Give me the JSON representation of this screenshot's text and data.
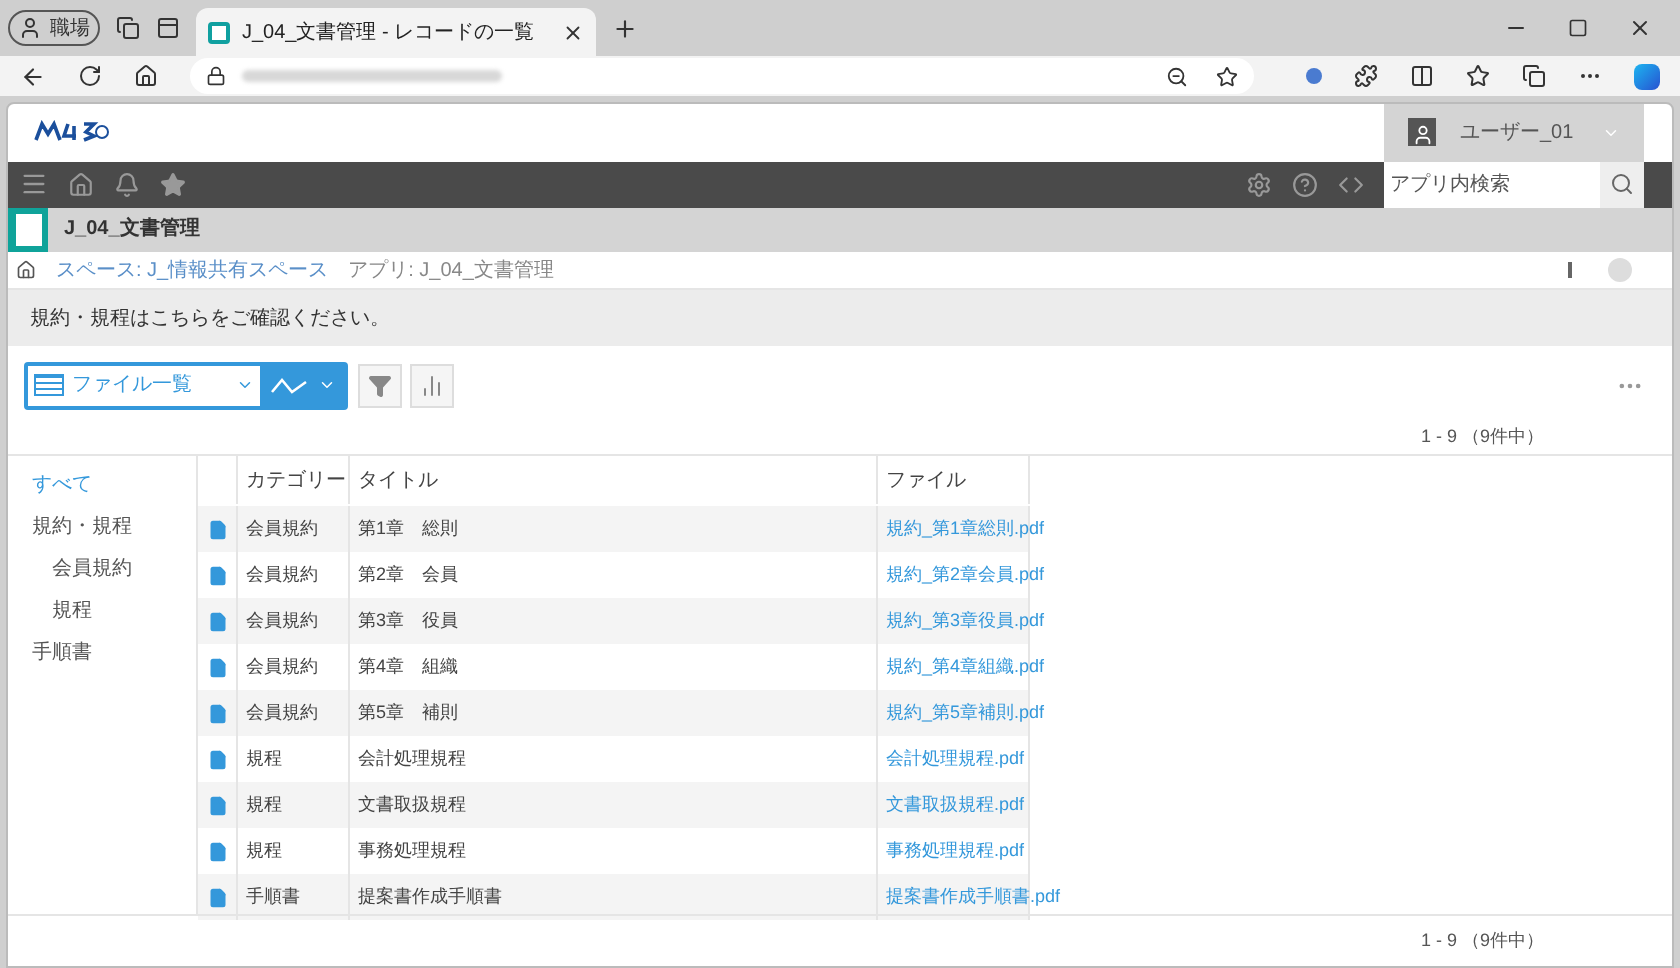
{
  "browser": {
    "profile": "職場",
    "tab_title": "J_04_文書管理 - レコードの一覧"
  },
  "header": {
    "user": "ユーザー_01",
    "search": {
      "placeholder": "アプリ内検索"
    }
  },
  "app": {
    "title": "J_04_文書管理"
  },
  "breadcrumb": [
    "スペース: J_情報共有スペース",
    "アプリ: J_04_文書管理"
  ],
  "notice": "規約・規程はこちらをご確認ください。",
  "view": {
    "name": "ファイル一覧"
  },
  "count_top": "1 - 9 （9件中）",
  "sidebar": [
    {
      "label": "すべて",
      "selected": true
    },
    {
      "label": "規約・規程",
      "selected": false,
      "children": [
        {
          "label": "会員規約",
          "selected": false
        },
        {
          "label": "規程",
          "selected": false
        }
      ]
    },
    {
      "label": "手順書",
      "selected": false
    }
  ],
  "table": {
    "columns": [
      "カテゴリー",
      "タイトル",
      "ファイル"
    ],
    "rows": [
      [
        "会員規約",
        "第1章　総則",
        "規約_第1章総則.pdf"
      ],
      [
        "会員規約",
        "第2章　会員",
        "規約_第2章会員.pdf"
      ],
      [
        "会員規約",
        "第3章　役員",
        "規約_第3章役員.pdf"
      ],
      [
        "会員規約",
        "第4章　組織",
        "規約_第4章組織.pdf"
      ],
      [
        "会員規約",
        "第5章　補則",
        "規約_第5章補則.pdf"
      ],
      [
        "規程",
        "会計処理規程",
        "会計処理規程.pdf"
      ],
      [
        "規程",
        "文書取扱規程",
        "文書取扱規程.pdf"
      ],
      [
        "規程",
        "事務処理規程",
        "事務処理規程.pdf"
      ],
      [
        "手順書",
        "提案書作成手順書",
        "提案書作成手順書.pdf"
      ]
    ]
  },
  "count_bottom": "1 - 9 （9件中）"
}
